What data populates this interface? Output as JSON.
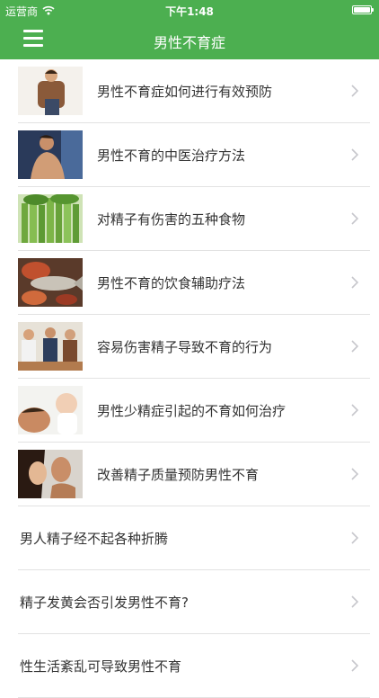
{
  "status_bar": {
    "carrier": "运营商",
    "time": "下午1:48",
    "wifi_icon": "wifi-icon",
    "battery_icon": "battery-icon"
  },
  "nav": {
    "title": "男性不育症",
    "menu_icon": "menu-icon",
    "color": "#4caf50"
  },
  "articles": [
    {
      "title": "男性不育症如何进行有效预防",
      "thumbnail": "man-in-sweater-photo"
    },
    {
      "title": "男性不育的中医治疗方法",
      "thumbnail": "shirtless-man-photo"
    },
    {
      "title": "对精子有伤害的五种食物",
      "thumbnail": "celery-photo"
    },
    {
      "title": "男性不育的饮食辅助疗法",
      "thumbnail": "seafood-photo"
    },
    {
      "title": "容易伤害精子导致不育的行为",
      "thumbnail": "men-drinking-photo"
    },
    {
      "title": "男性少精症引起的不育如何治疗",
      "thumbnail": "father-and-baby-photo"
    },
    {
      "title": "改善精子质量预防男性不育",
      "thumbnail": "couple-photo"
    },
    {
      "title": "男人精子经不起各种折腾"
    },
    {
      "title": "精子发黄会否引发男性不育?"
    },
    {
      "title": "性生活紊乱可导致男性不育"
    }
  ]
}
